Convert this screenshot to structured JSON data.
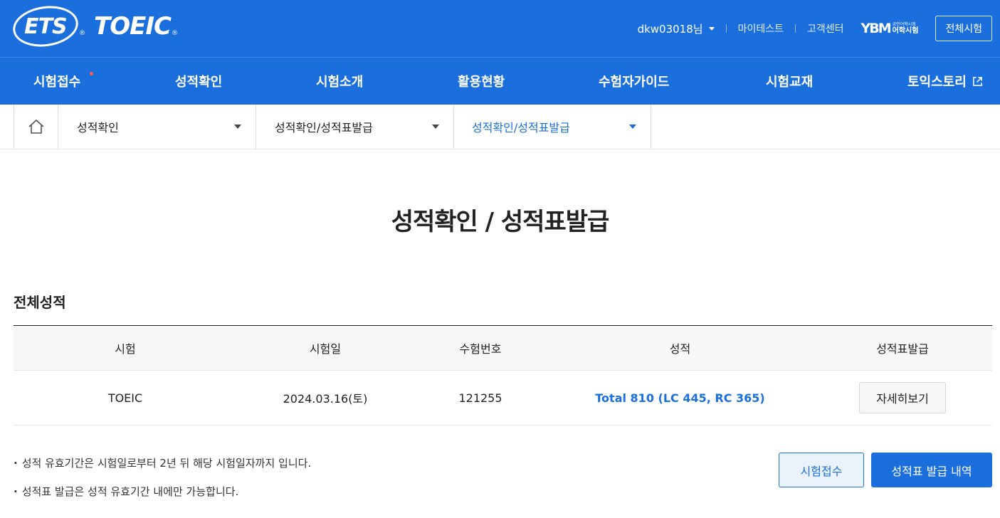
{
  "header": {
    "logo_ets": "ETS",
    "logo_toeic": "TOEIC",
    "reg_mark": "®",
    "username": "dkw03018님",
    "mytest": "마이테스트",
    "support": "고객센터",
    "ybm_mark": "YBM",
    "ybm_small": "공인어학시험",
    "ybm_main": "어학시험",
    "all_exams": "전체시험"
  },
  "nav": {
    "items": [
      {
        "label": "시험접수"
      },
      {
        "label": "성적확인"
      },
      {
        "label": "시험소개"
      },
      {
        "label": "활용현황"
      },
      {
        "label": "수험자가이드"
      },
      {
        "label": "시험교재"
      },
      {
        "label": "토익스토리"
      }
    ]
  },
  "breadcrumb": {
    "level1": "성적확인",
    "level2": "성적확인/성적표발급",
    "level3": "성적확인/성적표발급"
  },
  "page": {
    "title": "성적확인 / 성적표발급",
    "section": "전체성적"
  },
  "table": {
    "headers": [
      "시험",
      "시험일",
      "수험번호",
      "성적",
      "성적표발급"
    ],
    "rows": [
      {
        "exam": "TOEIC",
        "date": "2024.03.16(토)",
        "number": "121255",
        "score": "Total 810 (LC 445, RC 365)",
        "action": "자세히보기"
      }
    ]
  },
  "notes": [
    "성적 유효기간은 시험일로부터 2년 뒤 해당 시험일자까지 입니다.",
    "성적표 발급은 성적 유효기간 내에만 가능합니다."
  ],
  "buttons": {
    "apply": "시험접수",
    "history": "성적표 발급 내역"
  },
  "colors": {
    "brand": "#1a6fdc",
    "nav_dot": "#ff5b4a"
  }
}
